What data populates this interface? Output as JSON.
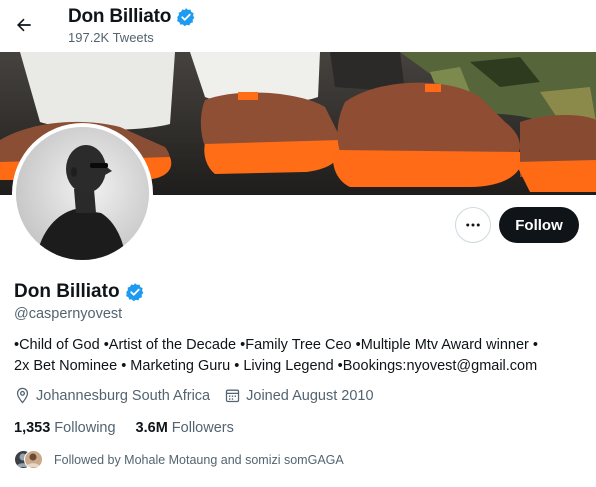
{
  "header": {
    "title": "Don Billiato",
    "subtitle": "197.2K Tweets",
    "back_icon": "arrow-left-icon"
  },
  "profile": {
    "name": "Don Billiato",
    "handle": "@caspernyovest",
    "verified_icon": "verified-badge-icon",
    "bio_line1": "•Child of God •Artist of the Decade •Family Tree Ceo •Multiple Mtv Award winner •",
    "bio_line2": "2x Bet Nominee • Marketing Guru • Living Legend •Bookings:nyovest@gmail.com",
    "location": "Johannesburg South Africa",
    "joined": "Joined August 2010",
    "following_count": "1,353",
    "following_label": "Following",
    "followers_count": "3.6M",
    "followers_label": "Followers",
    "followed_by": "Followed by Mohale Motaung and somizi somGAGA"
  },
  "actions": {
    "follow_label": "Follow",
    "more_icon": "more-options-icon"
  },
  "colors": {
    "verified": "#1d9bf0",
    "follow_bg": "#0f1419",
    "secondary_text": "#536471"
  }
}
